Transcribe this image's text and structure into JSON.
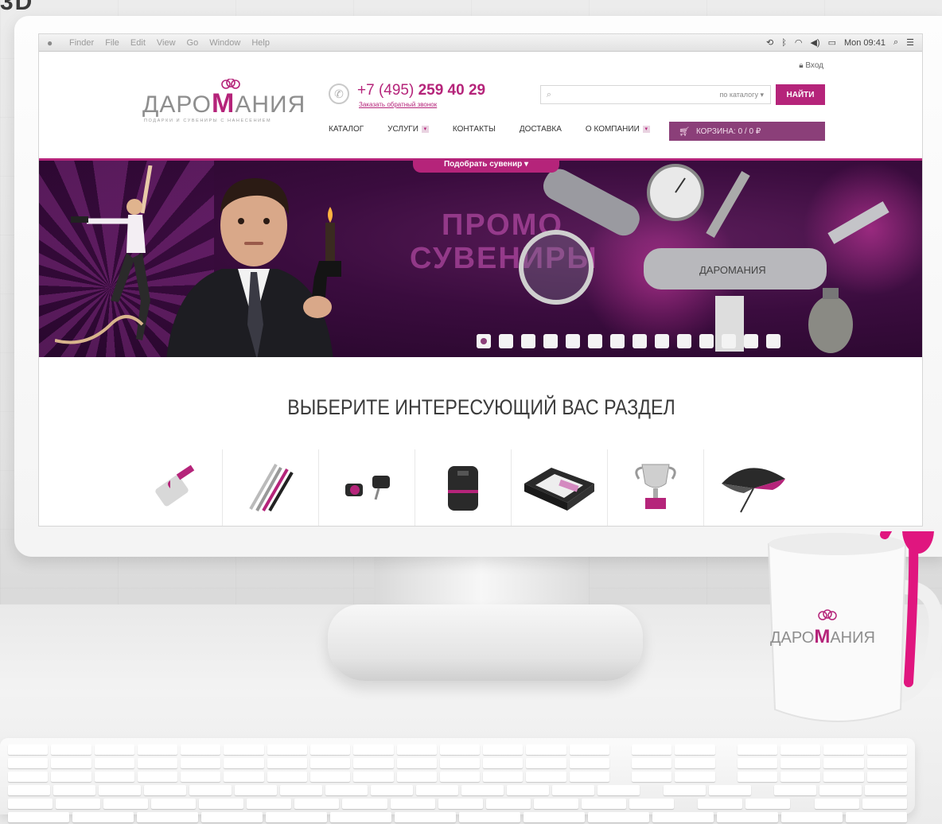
{
  "menubar": {
    "items": [
      "Finder",
      "File",
      "Edit",
      "View",
      "Go",
      "Window",
      "Help"
    ],
    "clock": "Mon 09:41"
  },
  "header": {
    "login_label": "Вход",
    "logo": {
      "name_prefix": "ДАРО",
      "name_m": "М",
      "name_suffix": "АНИЯ",
      "tagline": "ПОДАРКИ И СУВЕНИРЫ С НАНЕСЕНИЕМ"
    },
    "phone": {
      "prefix": "+7 (495)",
      "number": "259 40 29",
      "callback_label": "Заказать обратный звонок"
    },
    "search": {
      "placeholder": "",
      "scope_label": "по каталогу",
      "button_label": "НАЙТИ"
    },
    "nav": [
      {
        "label": "Каталог",
        "dropdown": false
      },
      {
        "label": "Услуги",
        "dropdown": true
      },
      {
        "label": "Контакты",
        "dropdown": false
      },
      {
        "label": "Доставка",
        "dropdown": false
      },
      {
        "label": "О компании",
        "dropdown": true
      }
    ],
    "cart_label": "КОРЗИНА: 0 / 0 ₽"
  },
  "banner": {
    "picker_label": "Подобрать сувенир",
    "promo_line1": "ПРОМО",
    "promo_line2": "СУВЕНИРЫ",
    "knife_brand": "ДАРОМАНИЯ",
    "slide_count": 14,
    "active_slide": 1
  },
  "sections": {
    "title": "ВЫБЕРИТЕ ИНТЕРЕСУЮЩИЙ ВАС РАЗДЕЛ",
    "items": [
      {
        "name": "keychain-icon"
      },
      {
        "name": "pens-icon"
      },
      {
        "name": "cufflinks-icon"
      },
      {
        "name": "speaker-icon"
      },
      {
        "name": "gift-box-icon"
      },
      {
        "name": "trophy-icon"
      },
      {
        "name": "umbrella-icon"
      }
    ]
  },
  "mug": {
    "brand_prefix": "ДАРО",
    "brand_m": "М",
    "brand_suffix": "АНИЯ"
  },
  "colors": {
    "brand": "#b5247a",
    "cart": "#8b3f79",
    "banner_dark": "#240628"
  }
}
